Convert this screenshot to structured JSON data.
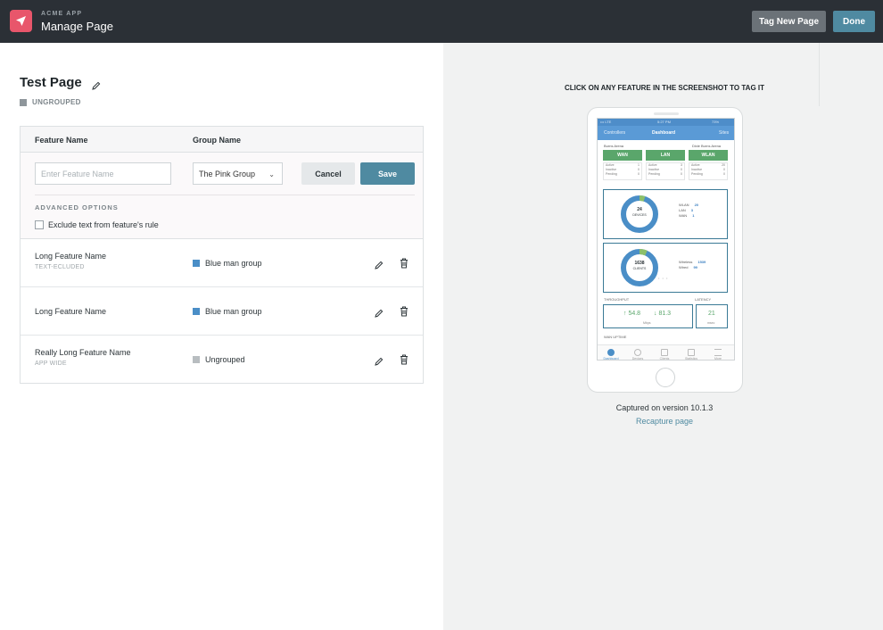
{
  "app": {
    "name": "ACME APP",
    "title": "Manage Page"
  },
  "header": {
    "tag_new_page_label": "Tag New Page",
    "done_label": "Done"
  },
  "page": {
    "title": "Test Page",
    "group": "UNGROUPED"
  },
  "table": {
    "columns": [
      "Feature Name",
      "Group Name"
    ],
    "new_feature": {
      "name_placeholder": "Enter Feature Name",
      "group_selected": "The Pink Group",
      "cancel_label": "Cancel",
      "save_label": "Save",
      "advanced_title": "ADVANCED OPTIONS",
      "exclude_text_label": "Exclude text from feature's rule",
      "exclude_text_checked": false
    },
    "rows": [
      {
        "name": "Long Feature Name",
        "sub": "TEXT-ECLUDED",
        "group": "Blue man group",
        "group_color": "#4a8ec7"
      },
      {
        "name": "Long Feature Name",
        "sub": "",
        "group": "Blue man group",
        "group_color": "#4a8ec7"
      },
      {
        "name": "Really Long Feature Name",
        "sub": "APP WIDE",
        "group": "Ungrouped",
        "group_color": "#b8bdc0"
      }
    ]
  },
  "preview": {
    "instruction": "CLICK ON ANY FEATURE IN THE SCREENSHOT TO TAG IT",
    "captured_text": "Captured on version 10.1.3",
    "recapture_label": "Recapture page",
    "screenshot": {
      "status_left": "••• LTE",
      "status_time": "5:27 PM",
      "status_right": "73%",
      "nav_left": "Controllers",
      "nav_title": "Dashboard",
      "nav_right": "Sites",
      "loc_left": "Burns Arena",
      "loc_right": "Dixie Burns Arena",
      "tabs": [
        "WAN",
        "LAN",
        "WLAN"
      ],
      "stats": [
        [
          [
            "Active",
            "1"
          ],
          [
            "Inactive",
            "0"
          ],
          [
            "Pending",
            "0"
          ]
        ],
        [
          [
            "Active",
            "3"
          ],
          [
            "Inactive",
            "0"
          ],
          [
            "Pending",
            "0"
          ]
        ],
        [
          [
            "Active",
            "20"
          ],
          [
            "Inactive",
            "0"
          ],
          [
            "Pending",
            "0"
          ]
        ]
      ],
      "devices_count": "24",
      "devices_label": "DEVICES",
      "devices_legend": [
        [
          "WLAN",
          "20"
        ],
        [
          "LAN",
          "3"
        ],
        [
          "WAN",
          "1"
        ]
      ],
      "clients_count": "1638",
      "clients_label": "CLIENTS",
      "clients_legend": [
        [
          "Wireless",
          "1539"
        ],
        [
          "Wired",
          "99"
        ]
      ],
      "throughput_label": "THROUGHPUT",
      "latency_label": "LATENCY",
      "up_value": "↑ 54.8",
      "down_value": "↓ 81.3",
      "throughput_unit": "Mbps",
      "latency_value": "21",
      "latency_unit": "msec",
      "wan_uptime_label": "WAN UPTIME",
      "tabbar": [
        "Dashboard",
        "Devices",
        "Clients",
        "Statistics",
        "More"
      ]
    }
  }
}
